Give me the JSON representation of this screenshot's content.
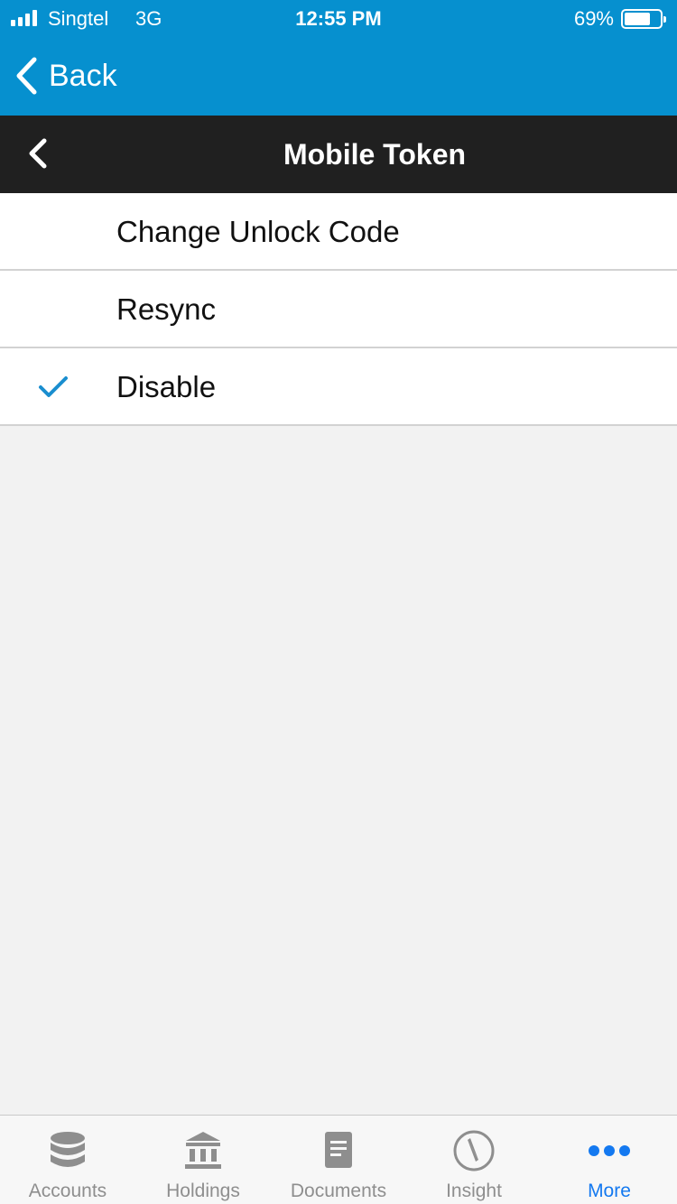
{
  "status_bar": {
    "carrier": "Singtel",
    "network": "3G",
    "time": "12:55 PM",
    "battery_percent": "69%",
    "battery_level": 0.69
  },
  "nav": {
    "back_label": "Back"
  },
  "header": {
    "title": "Mobile Token"
  },
  "menu": {
    "items": [
      {
        "label": "Change Unlock Code",
        "checked": false
      },
      {
        "label": "Resync",
        "checked": false
      },
      {
        "label": "Disable",
        "checked": true
      }
    ]
  },
  "tabs": [
    {
      "label": "Accounts",
      "icon": "database-icon",
      "active": false
    },
    {
      "label": "Holdings",
      "icon": "bank-icon",
      "active": false
    },
    {
      "label": "Documents",
      "icon": "document-icon",
      "active": false
    },
    {
      "label": "Insight",
      "icon": "compass-icon",
      "active": false
    },
    {
      "label": "More",
      "icon": "more-dots-icon",
      "active": true
    }
  ],
  "colors": {
    "topbar": "#0690cf",
    "titlebar": "#202020",
    "check": "#1a8ecf",
    "tab_active": "#1479f0",
    "tab_inactive": "#8e8e8e"
  }
}
